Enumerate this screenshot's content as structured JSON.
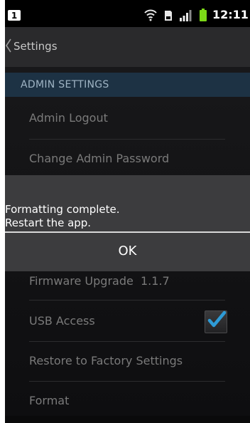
{
  "status_bar": {
    "notification_label": "1",
    "time": "12:11 PM",
    "icons": [
      "wifi-icon",
      "sd-card-icon",
      "signal-icon",
      "battery-icon"
    ],
    "battery_color": "#7cd817"
  },
  "action_bar": {
    "title": "Settings",
    "back_icon": "chevron-left-icon"
  },
  "settings": {
    "section_title": "ADMIN SETTINGS",
    "items": [
      {
        "label": "Admin Logout"
      },
      {
        "label": "Change Admin Password"
      },
      {
        "label": "Firmware Upgrade  1.1.7"
      },
      {
        "label": "USB Access",
        "checked": true
      },
      {
        "label": "Restore to Factory Settings"
      },
      {
        "label": "Format"
      }
    ]
  },
  "dialog": {
    "message_line1": "Formatting complete.",
    "message_line2": "Restart the app.",
    "ok_label": "OK"
  },
  "colors": {
    "section_header_bg": "#1d3244",
    "check_mark": "#2e9bd6"
  }
}
